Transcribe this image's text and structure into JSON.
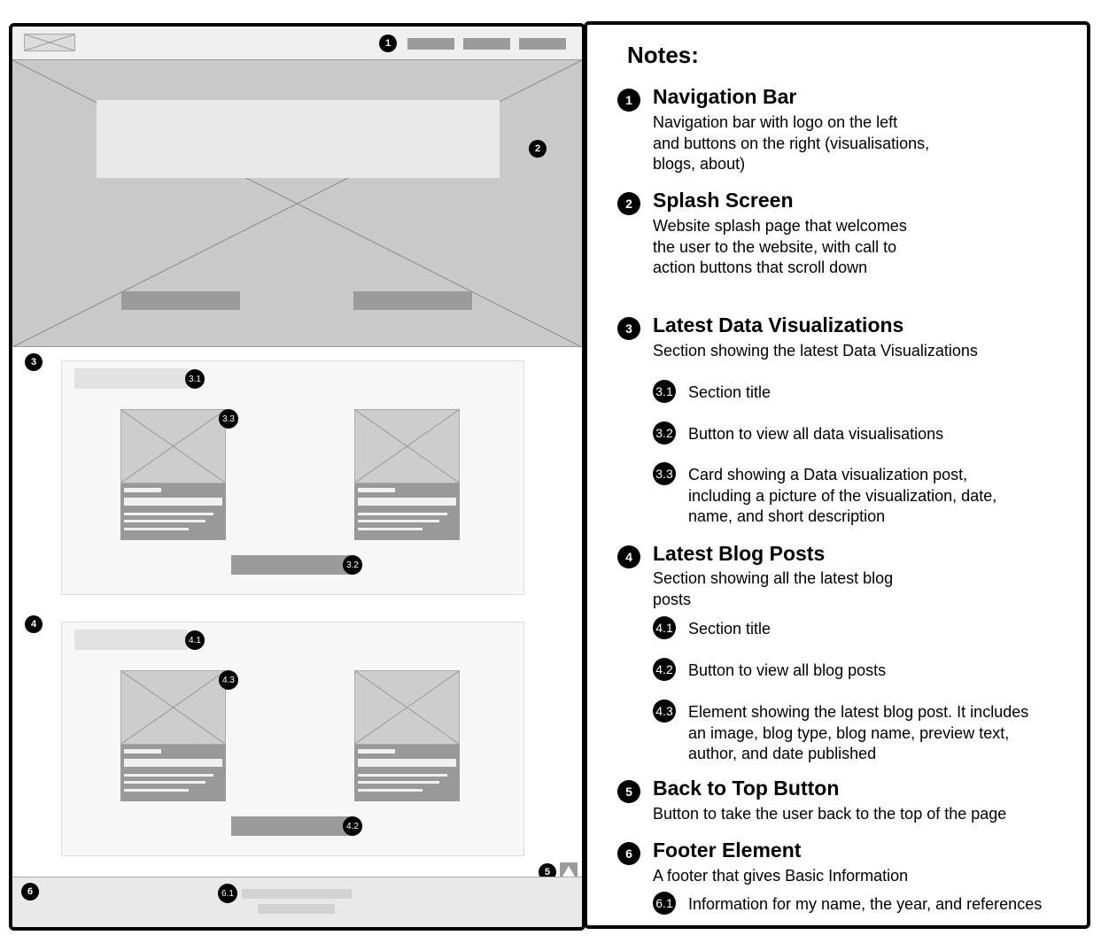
{
  "notes_title": "Notes:",
  "markers": {
    "nav": "1",
    "splash": "2",
    "viz": "3",
    "viz_title": "3.1",
    "viz_button": "3.2",
    "viz_card": "3.3",
    "blog": "4",
    "blog_title": "4.1",
    "blog_button": "4.2",
    "blog_card": "4.3",
    "back_top": "5",
    "footer": "6",
    "footer_info": "6.1"
  },
  "notes": {
    "nav": {
      "heading": "Navigation Bar",
      "desc_lines": [
        "Navigation bar with logo on the left",
        "and buttons on the right (visualisations,",
        "blogs, about)"
      ]
    },
    "splash": {
      "heading": "Splash Screen",
      "desc_lines": [
        "Website splash page that welcomes",
        "the user to the website, with call to",
        "action buttons that scroll down"
      ]
    },
    "viz": {
      "heading": "Latest Data Visualizations",
      "desc_lines": [
        "Section showing the latest Data Visualizations"
      ],
      "sub": [
        {
          "lines": [
            "Section title"
          ]
        },
        {
          "lines": [
            "Button to view all data visualisations"
          ]
        },
        {
          "lines": [
            "Card showing a Data visualization post,",
            "including a picture of the visualization, date,",
            "name, and short description"
          ]
        }
      ]
    },
    "blog": {
      "heading": "Latest Blog Posts",
      "desc_lines": [
        "Section showing all the latest blog",
        "posts"
      ],
      "sub": [
        {
          "lines": [
            "Section title"
          ]
        },
        {
          "lines": [
            "Button to view all blog posts"
          ]
        },
        {
          "lines": [
            "Element showing the latest blog post. It includes",
            "an image, blog type, blog name, preview text,",
            "author, and date published"
          ]
        }
      ]
    },
    "back_top": {
      "heading": "Back to Top Button",
      "desc_lines": [
        "Button to take the user back to the top of the page"
      ]
    },
    "footer": {
      "heading": "Footer Element",
      "desc_lines": [
        "A footer that gives Basic Information"
      ],
      "sub": [
        {
          "lines": [
            "Information for my name, the year, and references"
          ]
        }
      ]
    }
  },
  "colors": {
    "outline": "#000000",
    "placeholder_dark": "#9b9b9b",
    "placeholder_mid": "#c9c9c9",
    "placeholder_light": "#e9e9e9"
  }
}
